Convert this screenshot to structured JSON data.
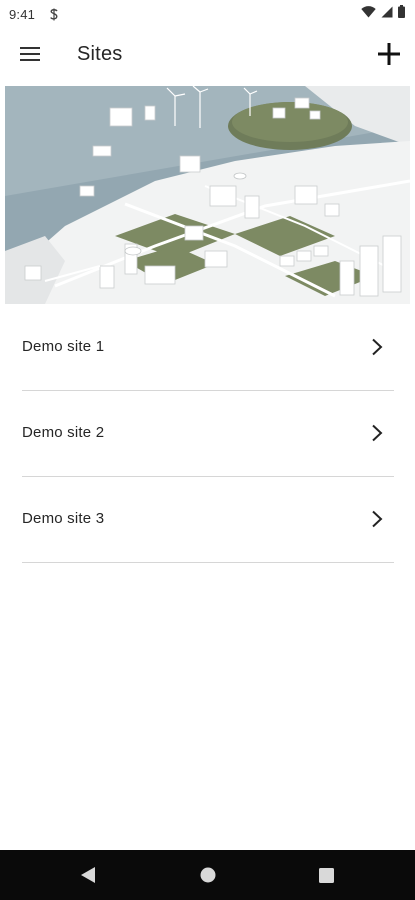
{
  "status_bar": {
    "time": "9:41",
    "icons": [
      "s-notification-icon",
      "wifi-icon",
      "cellular-signal-icon",
      "battery-icon"
    ]
  },
  "app_bar": {
    "title": "Sites",
    "menu_icon": "hamburger-menu-icon",
    "add_icon": "plus-icon"
  },
  "hero": {
    "image": "isometric industrial site illustration"
  },
  "sites": [
    {
      "label": "Demo site 1"
    },
    {
      "label": "Demo site 2"
    },
    {
      "label": "Demo site 3"
    }
  ],
  "nav_bar": {
    "icons": [
      "back-icon",
      "home-icon",
      "recents-icon"
    ]
  },
  "colors": {
    "background": "#ffffff",
    "text": "#262626",
    "divider": "#d6d6d6",
    "nav_bar": "#0a0a0a",
    "water": "#8fa3ad",
    "land": "#f4f4f4",
    "grass": "#7d8a63"
  }
}
